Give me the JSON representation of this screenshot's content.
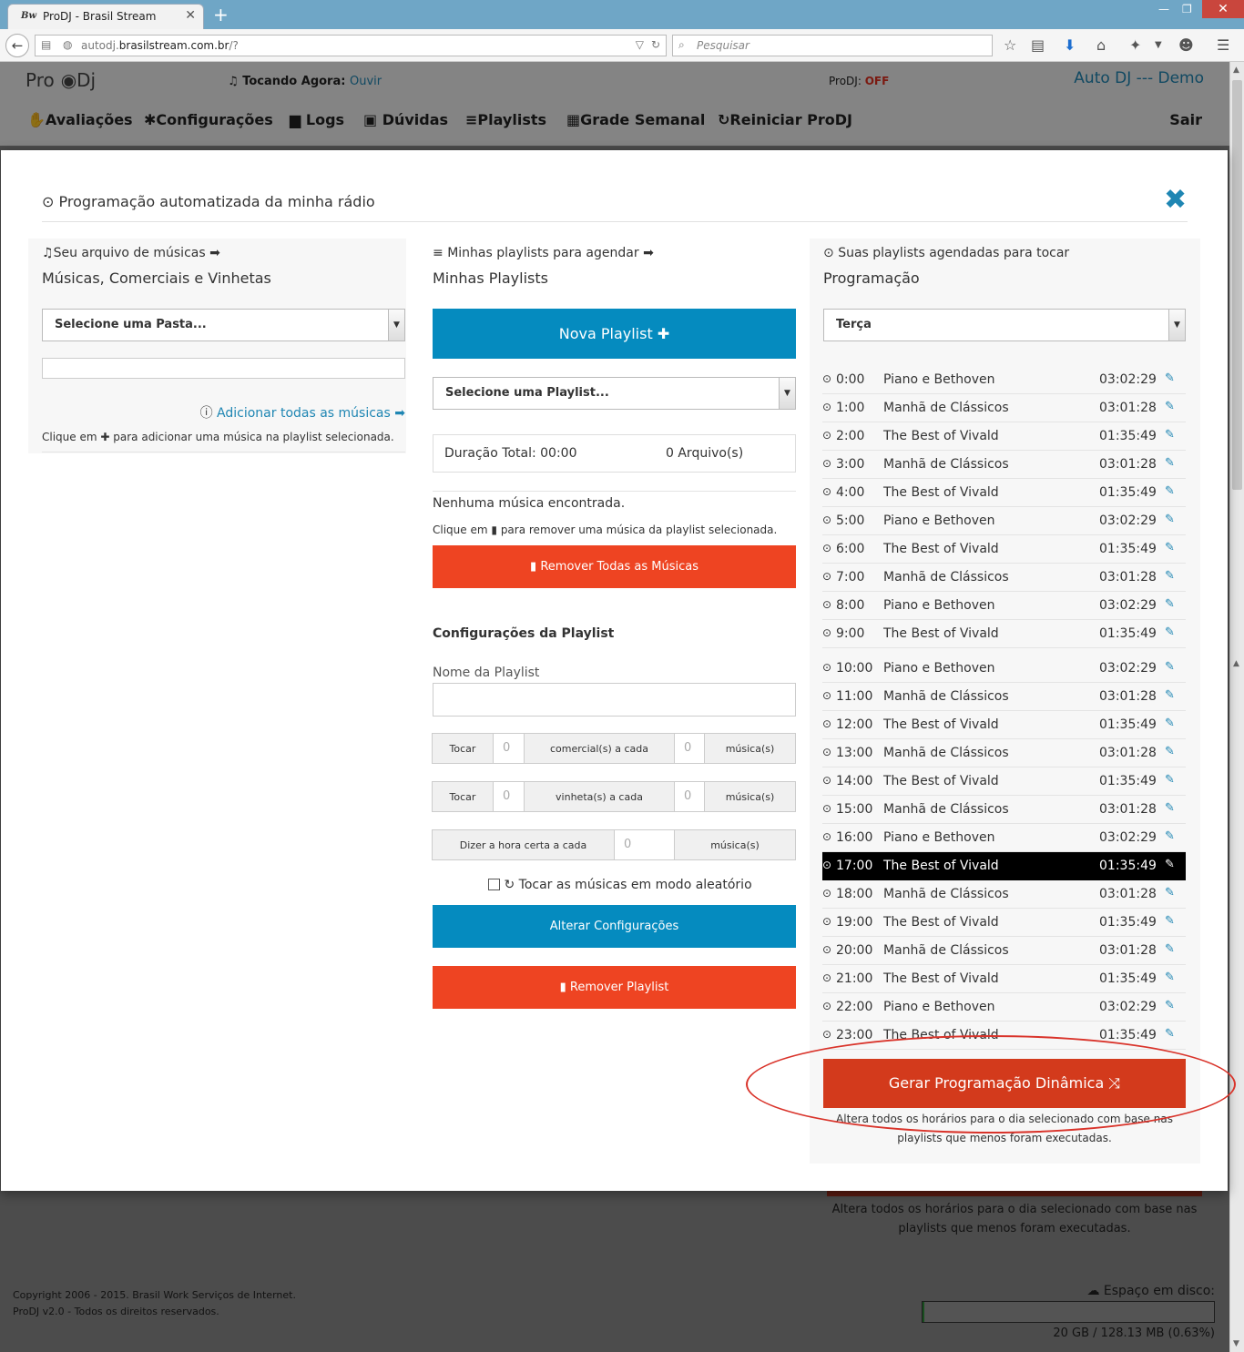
{
  "browser": {
    "tab_favicon": "Bw",
    "tab_title": "ProDJ - Brasil Stream",
    "url_prefix": "autodj.",
    "url_domain": "brasilstream.com.br",
    "url_suffix": "/?",
    "search_placeholder": "Pesquisar"
  },
  "header": {
    "logo_pro": "Pro",
    "logo_dj": "Dj",
    "now_playing_label": "Tocando Agora:",
    "now_playing_link": "Ouvir",
    "prodj_label": "ProDJ:",
    "prodj_value": "OFF",
    "account": "Auto DJ --- Demo"
  },
  "menu": [
    {
      "icon": "thumb-icon",
      "label": "Avaliações"
    },
    {
      "icon": "gear-icon",
      "label": "Configurações"
    },
    {
      "icon": "document-icon",
      "label": "Logs"
    },
    {
      "icon": "help-icon",
      "label": "Dúvidas"
    },
    {
      "icon": "list-icon",
      "label": "Playlists"
    },
    {
      "icon": "calendar-icon",
      "label": "Grade Semanal"
    },
    {
      "icon": "refresh-icon",
      "label": "Reiniciar ProDJ"
    }
  ],
  "logout": "Sair",
  "modal": {
    "title": "Programação automatizada da minha rádio"
  },
  "left_col": {
    "subtitle": "Seu arquivo de músicas",
    "title": "Músicas, Comerciais e Vinhetas",
    "folder_select": "Selecione uma Pasta...",
    "add_all_link": "Adicionar todas as músicas",
    "hint_before": "Clique em",
    "hint_after": "para adicionar uma música na playlist selecionada."
  },
  "middle_col": {
    "subtitle": "Minhas playlists para agendar",
    "title": "Minhas Playlists",
    "new_playlist_button": "Nova Playlist",
    "playlist_select": "Selecione uma Playlist...",
    "total_duration": "Duração Total: 00:00",
    "file_count": "0 Arquivo(s)",
    "empty_msg": "Nenhuma música encontrada.",
    "remove_hint_before": "Clique em",
    "remove_hint_after": "para remover uma música da playlist selecionada.",
    "remove_all_button": "Remover Todas as Músicas",
    "config_title": "Configurações da Playlist",
    "name_label": "Nome da Playlist",
    "name_value": "",
    "row1": {
      "play": "Tocar",
      "count": "0",
      "middle": "comercial(s) a cada",
      "every": "0",
      "unit": "música(s)"
    },
    "row2": {
      "play": "Tocar",
      "count": "0",
      "middle": "vinheta(s) a cada",
      "every": "0",
      "unit": "música(s)"
    },
    "row3": {
      "label": "Dizer a hora certa a cada",
      "every": "0",
      "unit": "música(s)"
    },
    "shuffle_label": "Tocar as músicas em modo aleatório",
    "save_button": "Alterar Configurações",
    "remove_playlist_button": "Remover Playlist"
  },
  "right_col": {
    "subtitle": "Suas playlists agendadas para tocar",
    "title": "Programação",
    "day_select": "Terça",
    "schedule": [
      {
        "time": "0:00",
        "name": "Piano e Bethoven",
        "duration": "03:02:29"
      },
      {
        "time": "1:00",
        "name": "Manhã de Clássicos",
        "duration": "03:01:28"
      },
      {
        "time": "2:00",
        "name": "The Best of Vivald",
        "duration": "01:35:49"
      },
      {
        "time": "3:00",
        "name": "Manhã de Clássicos",
        "duration": "03:01:28"
      },
      {
        "time": "4:00",
        "name": "The Best of Vivald",
        "duration": "01:35:49"
      },
      {
        "time": "5:00",
        "name": "Piano e Bethoven",
        "duration": "03:02:29"
      },
      {
        "time": "6:00",
        "name": "The Best of Vivald",
        "duration": "01:35:49"
      },
      {
        "time": "7:00",
        "name": "Manhã de Clássicos",
        "duration": "03:01:28"
      },
      {
        "time": "8:00",
        "name": "Piano e Bethoven",
        "duration": "03:02:29"
      },
      {
        "time": "9:00",
        "name": "The Best of Vivald",
        "duration": "01:35:49"
      },
      {
        "time": "10:00",
        "name": "Piano e Bethoven",
        "duration": "03:02:29"
      },
      {
        "time": "11:00",
        "name": "Manhã de Clássicos",
        "duration": "03:01:28"
      },
      {
        "time": "12:00",
        "name": "The Best of Vivald",
        "duration": "01:35:49"
      },
      {
        "time": "13:00",
        "name": "Manhã de Clássicos",
        "duration": "03:01:28"
      },
      {
        "time": "14:00",
        "name": "The Best of Vivald",
        "duration": "01:35:49"
      },
      {
        "time": "15:00",
        "name": "Manhã de Clássicos",
        "duration": "03:01:28"
      },
      {
        "time": "16:00",
        "name": "Piano e Bethoven",
        "duration": "03:02:29"
      },
      {
        "time": "17:00",
        "name": "The Best of Vivald",
        "duration": "01:35:49",
        "highlighted": true
      },
      {
        "time": "18:00",
        "name": "Manhã de Clássicos",
        "duration": "03:01:28"
      },
      {
        "time": "19:00",
        "name": "The Best of Vivald",
        "duration": "01:35:49"
      },
      {
        "time": "20:00",
        "name": "Manhã de Clássicos",
        "duration": "03:01:28"
      },
      {
        "time": "21:00",
        "name": "The Best of Vivald",
        "duration": "01:35:49"
      },
      {
        "time": "22:00",
        "name": "Piano e Bethoven",
        "duration": "03:02:29"
      },
      {
        "time": "23:00",
        "name": "The Best of Vivald",
        "duration": "01:35:49"
      }
    ],
    "generate_button": "Gerar Programação Dinâmica",
    "generate_note": "Altera todos os horários para o dia selecionado com base nas playlists que menos foram executadas."
  },
  "footer": {
    "copyright_line1": "Copyright 2006 - 2015. Brasil Work Serviços de Internet.",
    "copyright_line2": "ProDJ v2.0 - Todos os direitos reservados.",
    "disk_label": "Espaço em disco:",
    "disk_usage": "20 GB / 128.13 MB (0.63%)",
    "disk_used_fraction": 0.0063
  },
  "colors": {
    "accent_blue": "#058bbf",
    "danger_red": "#ee4422",
    "generate_red": "#d33a1c",
    "link_blue": "#1f86b3"
  }
}
